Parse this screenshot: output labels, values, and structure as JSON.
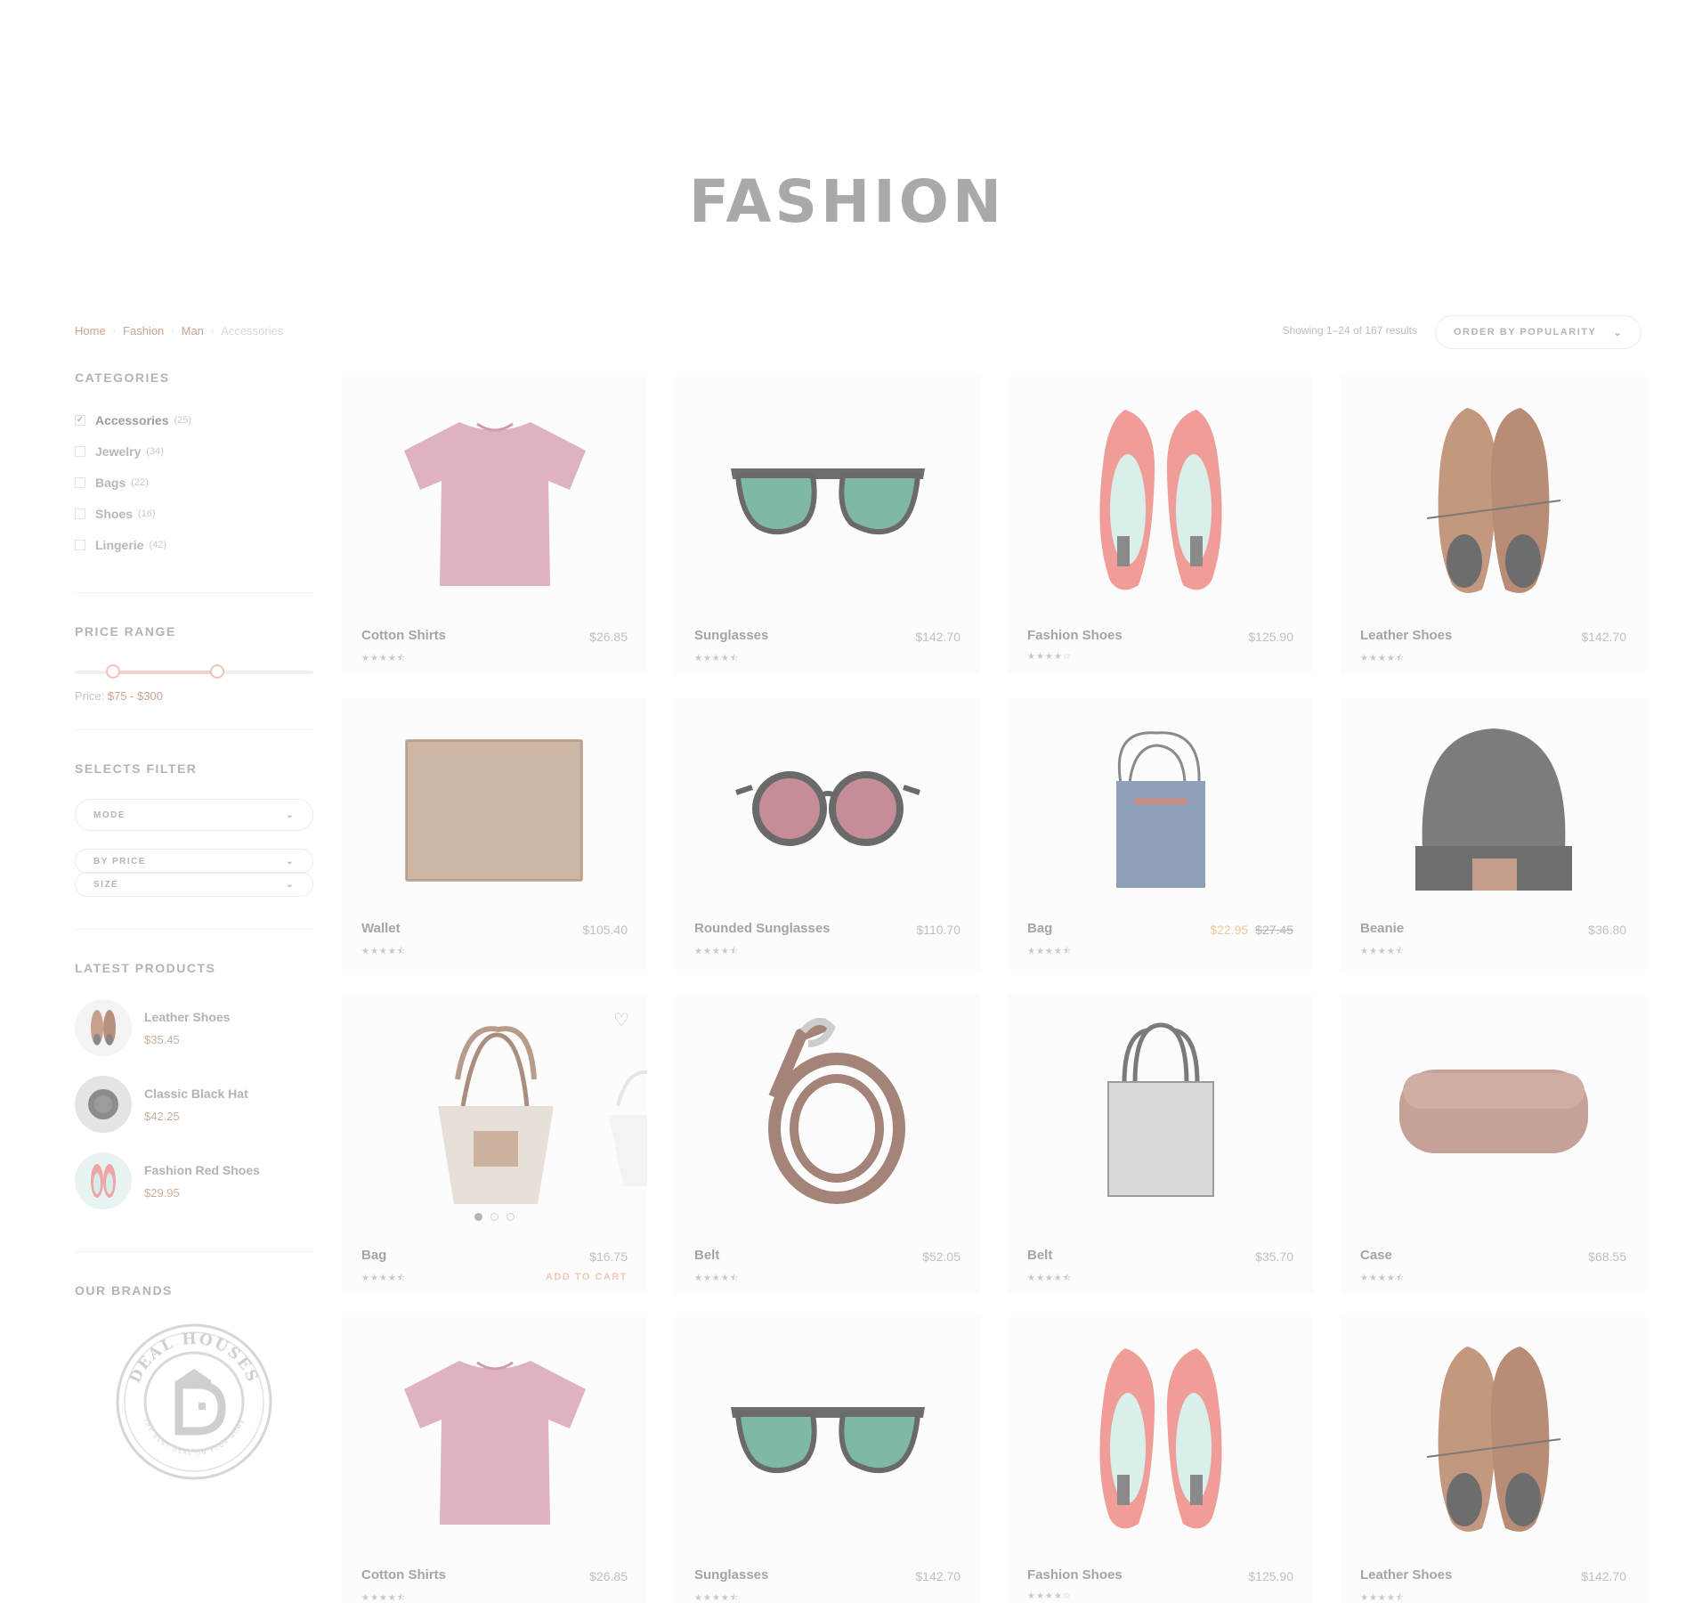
{
  "page": {
    "title": "FASHION"
  },
  "breadcrumb": {
    "items": [
      "Home",
      "Fashion",
      "Man"
    ],
    "current": "Accessories"
  },
  "toolbar": {
    "results_text": "Showing 1–24 of 167 results",
    "order_label": "ORDER BY POPULARITY"
  },
  "sidebar": {
    "categories": {
      "title": "CATEGORIES",
      "items": [
        {
          "name": "Accessories",
          "count": "(25)",
          "checked": "✓"
        },
        {
          "name": "Jewelry",
          "count": "(34)",
          "checked": ""
        },
        {
          "name": "Bags",
          "count": "(22)",
          "checked": ""
        },
        {
          "name": "Shoes",
          "count": "(16)",
          "checked": ""
        },
        {
          "name": "Lingerie",
          "count": "(42)",
          "checked": ""
        }
      ]
    },
    "price_range": {
      "title": "PRICE RANGE",
      "label": "Price: ",
      "value": "$75 - $300",
      "min": 75,
      "max": 300
    },
    "selects_filter": {
      "title": "SELECTS FILTER",
      "mode": "MODE",
      "by_price": "BY PRICE",
      "size": "SIZE"
    },
    "latest": {
      "title": "LATEST PRODUCTS",
      "items": [
        {
          "name": "Leather Shoes",
          "price": "$35.45",
          "icon": "shoes-icon"
        },
        {
          "name": "Classic Black Hat",
          "price": "$42.25",
          "icon": "hat-icon"
        },
        {
          "name": "Fashion Red Shoes",
          "price": "$29.95",
          "icon": "heels-icon"
        }
      ]
    },
    "brands": {
      "title": "OUR BRANDS",
      "logo_text": "DEAL HOUSES",
      "logo_tagline": "THE BEST DEAL ON YOUR HOME",
      "logo_letter": "D"
    }
  },
  "products": [
    {
      "name": "Cotton Shirts",
      "price": "$26.85",
      "stars": "★★★★⯪",
      "image": "tshirt"
    },
    {
      "name": "Sunglasses",
      "price": "$142.70",
      "stars": "★★★★⯪",
      "image": "sunglasses"
    },
    {
      "name": "Fashion Shoes",
      "price": "$125.90",
      "stars": "★★★★☆",
      "image": "heels"
    },
    {
      "name": "Leather Shoes",
      "price": "$142.70",
      "stars": "★★★★⯪",
      "image": "brogues"
    },
    {
      "name": "Wallet",
      "price": "$105.40",
      "stars": "★★★★⯪",
      "image": "wallet"
    },
    {
      "name": "Rounded Sunglasses",
      "price": "$110.70",
      "stars": "★★★★⯪",
      "image": "round-sunglasses"
    },
    {
      "name": "Bag",
      "sale_price": "$22.95",
      "old_price": "$27.45",
      "stars": "★★★★⯪",
      "image": "tote-blue"
    },
    {
      "name": "Beanie",
      "price": "$36.80",
      "stars": "★★★★⯪",
      "image": "beanie"
    },
    {
      "name": "Bag",
      "price": "$16.75",
      "stars": "★★★★⯪",
      "image": "basket-bag",
      "add_to_cart": "ADD TO CART"
    },
    {
      "name": "Belt",
      "price": "$52.05",
      "stars": "★★★★⯪",
      "image": "belt"
    },
    {
      "name": "Belt",
      "price": "$35.70",
      "stars": "★★★★⯪",
      "image": "tote-white"
    },
    {
      "name": "Case",
      "price": "$68.55",
      "stars": "★★★★⯪",
      "image": "case"
    },
    {
      "name": "Cotton Shirts",
      "price": "$26.85",
      "stars": "★★★★⯪",
      "image": "tshirt"
    },
    {
      "name": "Sunglasses",
      "price": "$142.70",
      "stars": "★★★★⯪",
      "image": "sunglasses"
    },
    {
      "name": "Fashion Shoes",
      "price": "$125.90",
      "stars": "★★★★☆",
      "image": "heels"
    },
    {
      "name": "Leather Shoes",
      "price": "$142.70",
      "stars": "★★★★⯪",
      "image": "brogues"
    }
  ],
  "colors": {
    "accent": "#c9a48f",
    "sale": "#e8c9a0",
    "add_to_cart": "#f0c9b8"
  }
}
